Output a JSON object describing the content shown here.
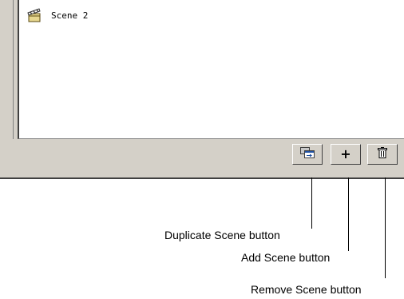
{
  "scene_list": {
    "items": [
      {
        "label": "Scene 2",
        "icon": "clapperboard-icon"
      }
    ]
  },
  "buttons": {
    "duplicate": {
      "icon": "duplicate-scene-icon"
    },
    "add": {
      "label": "+",
      "icon": "plus-icon"
    },
    "remove": {
      "icon": "trash-icon"
    }
  },
  "callouts": {
    "duplicate": "Duplicate Scene button",
    "add": "Add Scene button",
    "remove": "Remove Scene button"
  },
  "colors": {
    "panel_bg": "#d4d0c8",
    "list_bg": "#ffffff",
    "dark_edge": "#404040"
  }
}
